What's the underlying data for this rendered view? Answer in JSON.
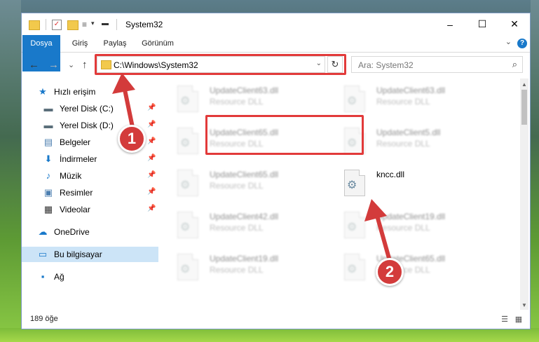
{
  "window": {
    "title": "System32",
    "controls": {
      "minimize": "–",
      "maximize": "☐",
      "close": "✕"
    }
  },
  "quick_access_toolbar": {
    "dropdown_glyph": "▾",
    "pin_glyph": "▬"
  },
  "ribbon": {
    "tabs": [
      "Dosya",
      "Giriş",
      "Paylaş",
      "Görünüm"
    ],
    "collapse_glyph": "⌄",
    "help_glyph": "?"
  },
  "nav": {
    "back_glyph": "←",
    "forward_glyph": "→",
    "recent_glyph": "⌄",
    "up_glyph": "↑",
    "address": "C:\\Windows\\System32",
    "address_drop_glyph": "⌄",
    "refresh_glyph": "↻",
    "search_placeholder": "Ara: System32",
    "search_glyph": "⌕"
  },
  "sidebar": {
    "pin_glyph": "📌",
    "items": [
      {
        "label": "Hızlı erişim",
        "icon": "star-icon",
        "glyph": "★",
        "color": "#1979ca"
      },
      {
        "label": "Yerel Disk (C:)",
        "icon": "drive-icon",
        "glyph": "▬",
        "color": "#5a6e7a"
      },
      {
        "label": "Yerel Disk (D:)",
        "icon": "drive-icon",
        "glyph": "▬",
        "color": "#5a6e7a"
      },
      {
        "label": "Belgeler",
        "icon": "documents-icon",
        "glyph": "▤",
        "color": "#4d7fb0"
      },
      {
        "label": "İndirmeler",
        "icon": "download-icon",
        "glyph": "⬇",
        "color": "#1979ca"
      },
      {
        "label": "Müzik",
        "icon": "music-icon",
        "glyph": "♪",
        "color": "#1979ca"
      },
      {
        "label": "Resimler",
        "icon": "pictures-icon",
        "glyph": "▣",
        "color": "#4d7fb0"
      },
      {
        "label": "Videolar",
        "icon": "video-icon",
        "glyph": "▦",
        "color": "#333333"
      },
      {
        "label": "OneDrive",
        "icon": "cloud-icon",
        "glyph": "☁",
        "color": "#1979ca"
      },
      {
        "label": "Bu bilgisayar",
        "icon": "computer-icon",
        "glyph": "▭",
        "color": "#1979ca"
      },
      {
        "label": "Ağ",
        "icon": "network-icon",
        "glyph": "▪",
        "color": "#1979ca"
      }
    ]
  },
  "files": [
    {
      "name": "UpdateClient63.dll",
      "desc": "Resource DLL"
    },
    {
      "name": "UpdateClient63.dll",
      "desc": "Resource DLL"
    },
    {
      "name": "UpdateClient65.dll",
      "desc": "Resource DLL"
    },
    {
      "name": "UpdateClient5.dll",
      "desc": "Resource DLL"
    },
    {
      "name": "UpdateClient65.dll",
      "desc": "Resource DLL"
    },
    {
      "name": "kncc.dll",
      "desc": ""
    },
    {
      "name": "UpdateClient42.dll",
      "desc": "Resource DLL"
    },
    {
      "name": "UpdateClient19.dll",
      "desc": "Resource DLL"
    },
    {
      "name": "UpdateClient19.dll",
      "desc": "Resource DLL"
    },
    {
      "name": "UpdateClient65.dll",
      "desc": "Resource DLL"
    }
  ],
  "file_icon_glyph": "⚙",
  "scroll": {
    "up_glyph": "▲",
    "down_glyph": "▼"
  },
  "status": {
    "count": "189 öğe",
    "details_glyph": "☰",
    "tiles_glyph": "▦"
  },
  "callouts": [
    {
      "label": "1",
      "target": "address bar"
    },
    {
      "label": "2",
      "target": "kncc.dll"
    }
  ],
  "colors": {
    "accent": "#1979ca",
    "highlight": "#e23a3a",
    "callout": "#d33b3b"
  }
}
